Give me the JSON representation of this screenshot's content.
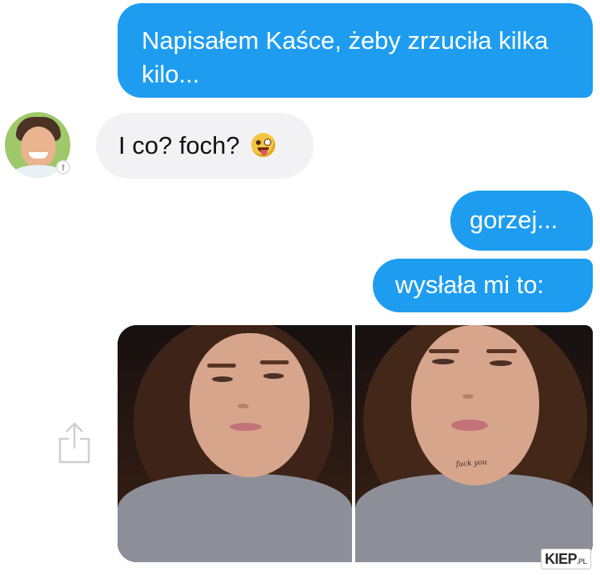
{
  "messages": [
    {
      "side": "sent",
      "text": "Napisałem Kaśce, żeby zrzuciła kilka kilo..."
    },
    {
      "side": "received",
      "text": "I co? foch?",
      "emoji": "winking-tongue-emoji"
    },
    {
      "side": "sent",
      "text": "gorzej..."
    },
    {
      "side": "sent",
      "text": "wysłała mi to:"
    }
  ],
  "attachment": {
    "photos": [
      {
        "icon": "selfie-photo-before"
      },
      {
        "icon": "selfie-photo-after",
        "neck_text": "fuck you"
      }
    ]
  },
  "icons": {
    "avatar": "contact-avatar",
    "share": "share-icon",
    "messenger_badge": "messenger-badge-icon"
  },
  "colors": {
    "sent_bubble": "#1e9df0",
    "received_bubble": "#f2f2f4"
  },
  "watermark": {
    "main": "KIEP",
    "suffix": ".PL"
  }
}
